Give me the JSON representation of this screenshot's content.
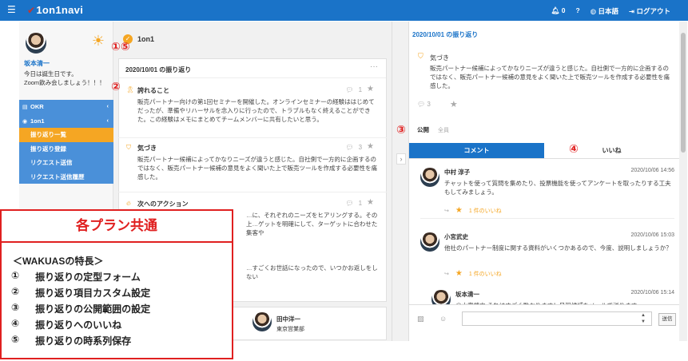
{
  "topbar": {
    "logo": "1on1navi",
    "notif_count": "0",
    "lang": "日本語",
    "logout": "ログアウト"
  },
  "sidebar": {
    "user_name": "坂本清一",
    "message_line1": "今日は誕生日です。",
    "message_line2": "Zoom飲み会しましょう！！！",
    "menu": [
      {
        "label": "OKR",
        "icon": "chart-icon",
        "expand": "‹"
      },
      {
        "label": "1on1",
        "icon": "check-icon",
        "expand": "‹"
      },
      {
        "label": "振り返り一覧",
        "active": true
      },
      {
        "label": "振り返り登録"
      },
      {
        "label": "リクエスト送信"
      },
      {
        "label": "リクエスト送信履歴"
      }
    ]
  },
  "middle": {
    "header_title": "1on1",
    "card_title": "2020/10/01 の振り返り",
    "entries": [
      {
        "label": "誇れること",
        "icon": "ribbon-icon",
        "count": "1",
        "body": "販売パートナー向けの第1回セミナーを開催した。オンラインセミナーの経験ははじめてだったが、準備やリハーサルを念入りに行ったので、トラブルもなく終えることができた。この経験はメモにまとめてチームメンバーに共有したいと思う。"
      },
      {
        "label": "気づき",
        "icon": "shield-icon",
        "count": "3",
        "body": "販売パートナー候補によってかなりニーズが違うと感じた。自社側で一方的に企画するのではなく、販売パートナー候補の意見をよく聞いた上で販売ツールを作成する必要性を痛感した。"
      },
      {
        "label": "次へのアクション",
        "icon": "flame-icon",
        "count": "1",
        "body": "…に、それぞれのニーズをヒアリングする。その上…ゲットを明確にして、ターゲットに合わせた集客や"
      },
      {
        "label": "",
        "icon": "",
        "count": "",
        "body": "…すごくお世話になったので、いつかお返しをしない"
      }
    ],
    "bottom_user": {
      "name": "田中洋一",
      "dept": "東京営業部"
    }
  },
  "right": {
    "date_title": "2020/10/01 の振り返り",
    "kizuki_label": "気づき",
    "kizuki_body": "販売パートナー候補によってかなりニーズが違うと感じた。自社側で一方的に企画するのではなく、販売パートナー候補の意見をよく聞いた上で販売ツールを作成する必要性を痛感した。",
    "kizuki_count": "3",
    "public_label": "公開",
    "public_value": "全員",
    "tabs": [
      "コメント",
      "いいね"
    ],
    "comments": [
      {
        "name": "中村 淳子",
        "date": "2020/10/06 14:56",
        "text": "チャットを使って質問を集めたり、投票機能を使ってアンケートを取ったりする工夫もしてみましょう。",
        "likes": "1 件のいいね"
      },
      {
        "name": "小宮武史",
        "date": "2020/10/06 15:03",
        "text": "他社のパートナー制度に関する資料がいくつかあるので、今度、説明しましょうか？",
        "likes": "1 件のいいね"
      },
      {
        "name": "坂本清一",
        "date": "2020/10/06 15:14",
        "text": "@小宮武史 それはすごく助かります！日程候補をメールで送ります。",
        "likes": ""
      }
    ],
    "send_label": "送信"
  },
  "callouts": {
    "c15": "①⑤",
    "c2": "②",
    "c3": "③",
    "c4": "④"
  },
  "overlay": {
    "title": "各プラン共通",
    "subtitle": "＜WAKUASの特長＞",
    "items": [
      {
        "num": "①",
        "text": "振り返りの定型フォーム"
      },
      {
        "num": "②",
        "text": "振り返り項目カスタム設定"
      },
      {
        "num": "③",
        "text": "振り返りの公開範囲の設定"
      },
      {
        "num": "④",
        "text": "振り返りへのいいね"
      },
      {
        "num": "⑤",
        "text": "振り返りの時系列保存"
      }
    ]
  },
  "colors": {
    "brand": "#1a73c8",
    "accent": "#f5a623",
    "callout": "#e02020"
  }
}
